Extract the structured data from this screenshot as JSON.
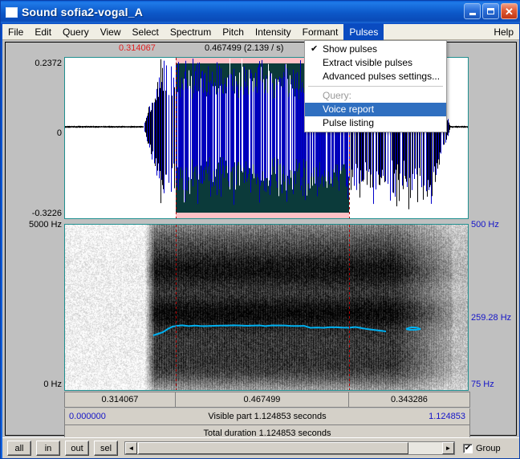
{
  "window": {
    "title": "Sound sofia2-vogal_A",
    "icon": "sound-window-icon",
    "minimize_label": "Minimize",
    "maximize_label": "Maximize",
    "close_label": "Close"
  },
  "menubar": {
    "items": [
      {
        "label": "File",
        "active": false
      },
      {
        "label": "Edit",
        "active": false
      },
      {
        "label": "Query",
        "active": false
      },
      {
        "label": "View",
        "active": false
      },
      {
        "label": "Select",
        "active": false
      },
      {
        "label": "Spectrum",
        "active": false
      },
      {
        "label": "Pitch",
        "active": false
      },
      {
        "label": "Intensity",
        "active": false
      },
      {
        "label": "Formant",
        "active": false
      },
      {
        "label": "Pulses",
        "active": true
      }
    ],
    "help_label": "Help"
  },
  "dropdown": {
    "owner": "Pulses",
    "items": [
      {
        "label": "Show pulses",
        "checked": true,
        "disabled": false,
        "selected": false,
        "separator_after": false
      },
      {
        "label": "Extract visible pulses",
        "checked": false,
        "disabled": false,
        "selected": false,
        "separator_after": false
      },
      {
        "label": "Advanced pulses settings...",
        "checked": false,
        "disabled": false,
        "selected": false,
        "separator_after": true
      },
      {
        "label": "Query:",
        "checked": false,
        "disabled": true,
        "selected": false,
        "separator_after": false
      },
      {
        "label": "Voice report",
        "checked": false,
        "disabled": false,
        "selected": true,
        "separator_after": false
      },
      {
        "label": "Pulse listing",
        "checked": false,
        "disabled": false,
        "selected": false,
        "separator_after": false
      }
    ]
  },
  "waveform": {
    "cursor_time_label": "0.314067",
    "selection_label": "0.467499 (2.139 / s)",
    "y_max": "0.2372",
    "y_zero": "0",
    "y_min": "-0.3226",
    "selection_fill_color": "#0b3a3a",
    "selection_band_color": "#ffbec3",
    "pulse_color": "#0000cc",
    "border_color": "#1f8f8f"
  },
  "spectrogram": {
    "freq_top": "5000 Hz",
    "freq_bottom": "0 Hz",
    "pitch_top": "500 Hz",
    "pitch_value": "259.28 Hz",
    "pitch_bottom": "75 Hz",
    "pitch_track_color": "#00b0f0"
  },
  "timebar": {
    "segments": [
      "0.314067",
      "0.467499",
      "0.343286"
    ]
  },
  "visible_part": {
    "start": "0.000000",
    "label": "Visible part 1.124853 seconds",
    "end": "1.124853"
  },
  "total_duration": {
    "label": "Total duration 1.124853 seconds"
  },
  "toolbar": {
    "buttons": [
      {
        "label": "all"
      },
      {
        "label": "in"
      },
      {
        "label": "out"
      },
      {
        "label": "sel"
      }
    ],
    "scroll_left_glyph": "◄",
    "scroll_right_glyph": "►",
    "group_label": "Group",
    "group_checked": true,
    "group_check_glyph": "✔"
  }
}
